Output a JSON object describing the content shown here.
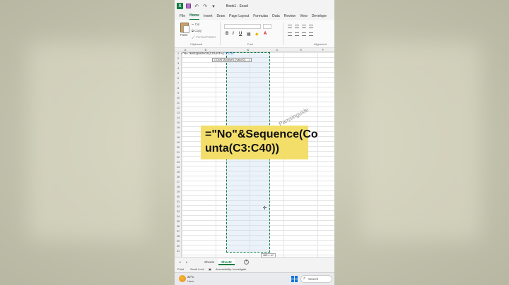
{
  "window": {
    "title": "Book1 - Excel",
    "app_icon": "X"
  },
  "menu": [
    "File",
    "Home",
    "Insert",
    "Draw",
    "Page Layout",
    "Formulas",
    "Data",
    "Review",
    "View",
    "Develope"
  ],
  "ribbon": {
    "paste_label": "Paste",
    "cut_label": "Cut",
    "copy_label": "Copy",
    "format_painter_label": "Format Painter",
    "clipboard_group": "Clipboard",
    "font_group": "Font",
    "alignment_group": "Alignment",
    "bold": "B",
    "italic": "I",
    "underline": "U"
  },
  "columns": [
    "A",
    "B",
    "C",
    "D",
    "E",
    "F"
  ],
  "rows": [
    "1",
    "2",
    "3",
    "4",
    "5",
    "6",
    "7",
    "8",
    "9",
    "10",
    "11",
    "12",
    "13",
    "14",
    "15",
    "16",
    "17",
    "18",
    "19",
    "20",
    "21",
    "22",
    "23",
    "24",
    "25",
    "26",
    "27",
    "28",
    "29",
    "30",
    "31",
    "32",
    "33",
    "34",
    "35",
    "36",
    "37",
    "38",
    "39",
    "40",
    "41"
  ],
  "cell": {
    "formula_prefix": "=\"No \"&SEQUENCE(COUNTA(",
    "formula_ref": "C3:C40",
    "tooltip": "COUNTA(value1, [value2], ...)"
  },
  "selection_size": "38R x 1C",
  "caption": {
    "line1": "=\"No\"&Sequence(Co",
    "line2": "unta(C3:C40))"
  },
  "watermark": "Pamsinguide",
  "sheets": {
    "tabs": [
      "Sheet1",
      "Sheet2"
    ],
    "active": "Sheet2"
  },
  "status": {
    "mode": "Point",
    "scroll_lock": "Scroll Lock",
    "accessibility": "Accessibility: Investigate"
  },
  "taskbar": {
    "temperature": "22°C",
    "condition": "Haze",
    "search_placeholder": "Search"
  },
  "colors": {
    "excel_green": "#107c41",
    "caption_bg": "#f3de6a",
    "selection_fill": "#c5dbf0"
  }
}
